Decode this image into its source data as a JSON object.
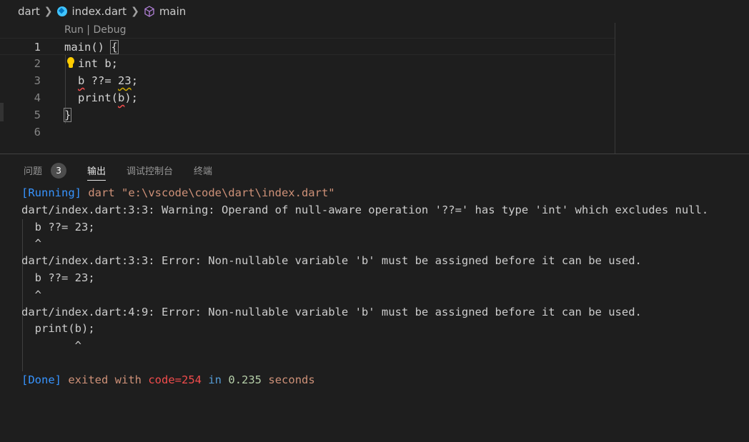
{
  "breadcrumb": {
    "folder": "dart",
    "file": "index.dart",
    "symbol": "main"
  },
  "editor": {
    "codelens": "Run | Debug",
    "lines": [
      {
        "num": "1",
        "text": "main() {"
      },
      {
        "num": "2",
        "text": "int b;"
      },
      {
        "num": "3",
        "text": "b ??= 23;"
      },
      {
        "num": "4",
        "text": "print(b);"
      },
      {
        "num": "5",
        "text": "}"
      },
      {
        "num": "6",
        "text": ""
      }
    ]
  },
  "panel": {
    "tabs": [
      {
        "label": "问题",
        "badge": "3"
      },
      {
        "label": "输出"
      },
      {
        "label": "调试控制台"
      },
      {
        "label": "终端"
      }
    ],
    "output": {
      "running_tag": "[Running]",
      "running_cmd": "dart \"e:\\vscode\\code\\dart\\index.dart\"",
      "lines": [
        "dart/index.dart:3:3: Warning: Operand of null-aware operation '??=' has type 'int' which excludes null.",
        "  b ??= 23;",
        "  ^",
        "dart/index.dart:3:3: Error: Non-nullable variable 'b' must be assigned before it can be used.",
        "  b ??= 23;",
        "  ^",
        "dart/index.dart:4:9: Error: Non-nullable variable 'b' must be assigned before it can be used.",
        "  print(b);",
        "        ^"
      ],
      "done_tag": "[Done]",
      "done_exited": "exited with",
      "done_code": "code=254",
      "done_in": "in",
      "done_time": "0.235",
      "done_seconds": "seconds"
    }
  },
  "colors": {
    "background": "#1e1e1e",
    "accent_blue": "#569cd6",
    "error_red": "#f14c4c",
    "bulb_yellow": "#ffcc00"
  }
}
